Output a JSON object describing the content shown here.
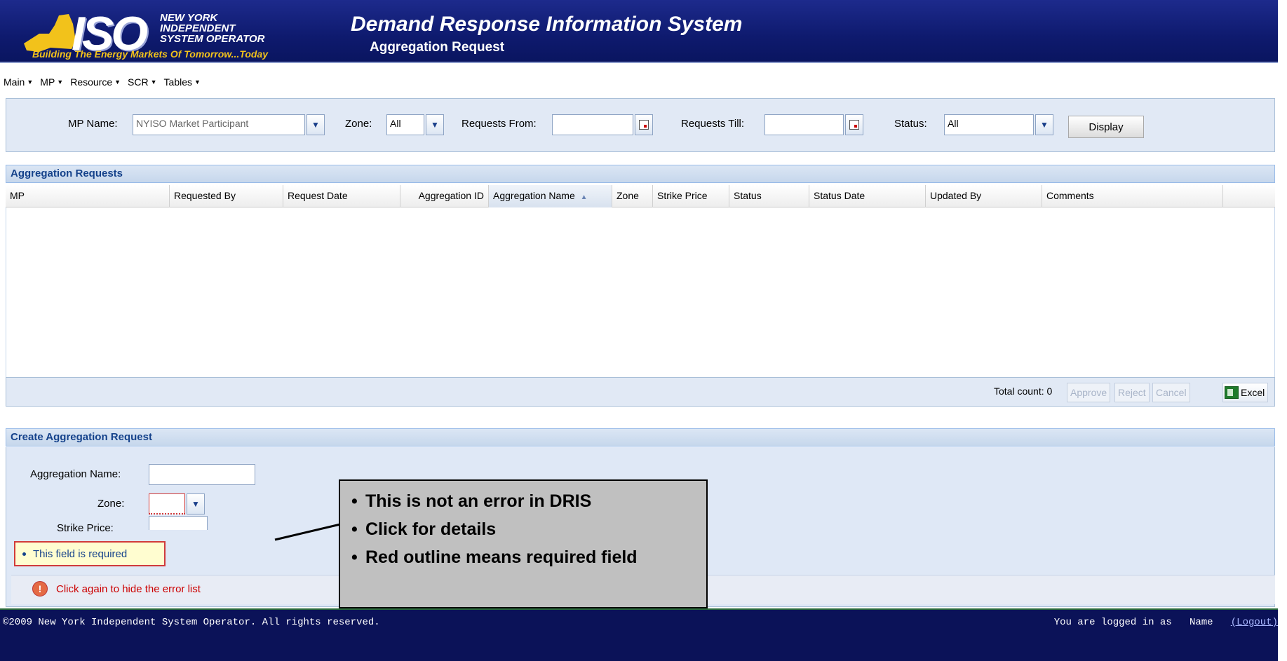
{
  "header": {
    "logo_text": "ISO",
    "logo_line1": "NEW YORK",
    "logo_line2": "INDEPENDENT",
    "logo_line3": "SYSTEM OPERATOR",
    "logo_tagline": "Building The Energy Markets Of Tomorrow...Today",
    "title": "Demand Response Information System",
    "subtitle": "Aggregation Request"
  },
  "menu": [
    {
      "label": "Main"
    },
    {
      "label": "MP"
    },
    {
      "label": "Resource"
    },
    {
      "label": "SCR"
    },
    {
      "label": "Tables"
    }
  ],
  "filter": {
    "mp_name_label": "MP Name:",
    "mp_name_value": "NYISO Market Participant",
    "zone_label": "Zone:",
    "zone_value": "All",
    "from_label": "Requests From:",
    "from_value": "",
    "till_label": "Requests Till:",
    "till_value": "",
    "status_label": "Status:",
    "status_value": "All",
    "display_button": "Display"
  },
  "grid": {
    "title": "Aggregation Requests",
    "columns": [
      "MP",
      "Requested By",
      "Request Date",
      "Aggregation ID",
      "Aggregation Name",
      "Zone",
      "Strike Price",
      "Status",
      "Status Date",
      "Updated By",
      "Comments"
    ],
    "sort_indicator": "▲",
    "total_count_text": "Total count: 0",
    "approve": "Approve",
    "reject": "Reject",
    "cancel": "Cancel",
    "excel": "Excel"
  },
  "create": {
    "title": "Create Aggregation Request",
    "aggregation_name_label": "Aggregation Name:",
    "zone_label": "Zone:",
    "strike_price_label": "Strike Price:",
    "error_item": "This field is required",
    "error_toggle": "Click again to hide the error list"
  },
  "callout": {
    "items": [
      "This is not an error in DRIS",
      "Click for details",
      "Red outline means required field"
    ]
  },
  "footer": {
    "copyright": "©2009  New York Independent System Operator. All rights reserved.",
    "logged_in": "You are logged in as",
    "user_name": "Name",
    "logout": "(Logout)"
  },
  "colors": {
    "header_bg": "#0e1a6e",
    "panel_bg": "#e1e9f5",
    "panel_title": "#15428b",
    "error_red": "#d13b3b",
    "tagline": "#f2c21b"
  }
}
